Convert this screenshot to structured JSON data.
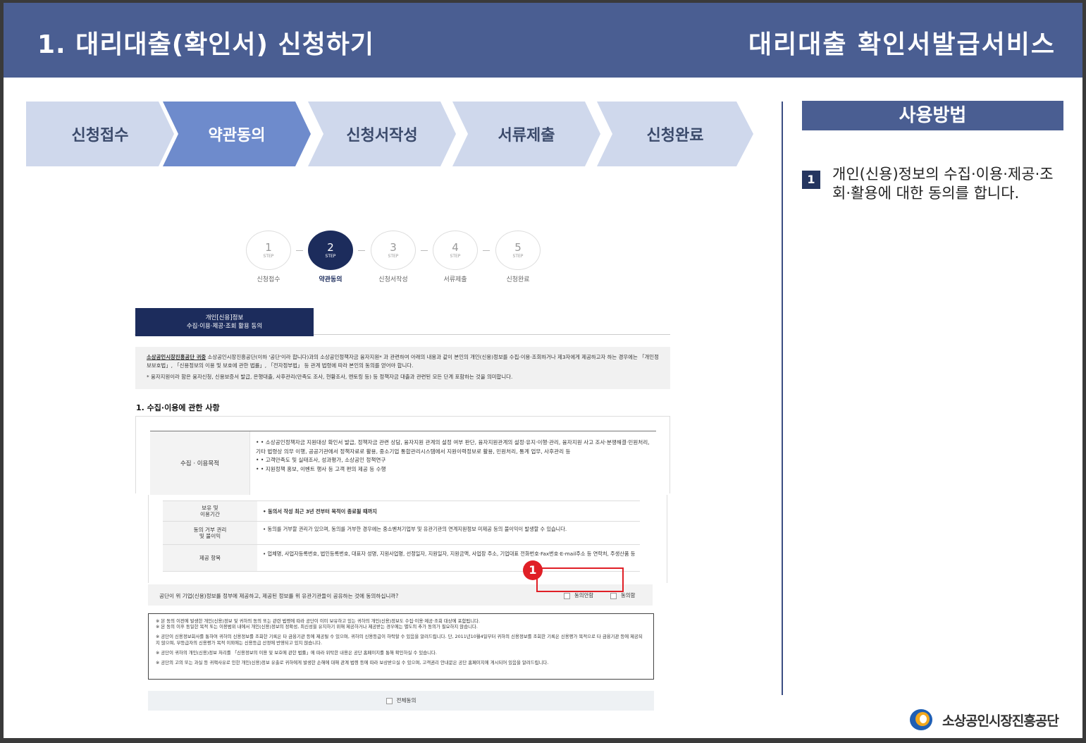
{
  "header": {
    "title": "1. 대리대출(확인서) 신청하기",
    "service": "대리대출 확인서발급서비스"
  },
  "flow": {
    "steps": [
      {
        "label": "신청접수",
        "color": "#cfd8ec"
      },
      {
        "label": "약관동의",
        "color": "#6e8bcc"
      },
      {
        "label": "신청서작성",
        "color": "#cfd8ec"
      },
      {
        "label": "서류제출",
        "color": "#cfd8ec"
      },
      {
        "label": "신청완료",
        "color": "#cfd8ec"
      }
    ],
    "active_index": 1
  },
  "guide": {
    "title": "사용방법",
    "items": [
      {
        "num": "1",
        "text": "개인(신용)정보의 수집·이용·제공·조회·활용에 대한 동의를 합니다."
      }
    ]
  },
  "logo": {
    "name": "소상공인시장진흥공단"
  },
  "screenshot": {
    "steps": [
      {
        "num": "1",
        "sub": "STEP",
        "label": "신청접수"
      },
      {
        "num": "2",
        "sub": "STEP",
        "label": "약관동의"
      },
      {
        "num": "3",
        "sub": "STEP",
        "label": "신청서작성"
      },
      {
        "num": "4",
        "sub": "STEP",
        "label": "서류제출"
      },
      {
        "num": "5",
        "sub": "STEP",
        "label": "신청완료"
      }
    ],
    "tab": {
      "line1": "개인[신용]정보",
      "line2": "수집·이용·제공·조회 활용 동의"
    },
    "notice": {
      "p1_org": "소상공인시장진흥공단 귀중",
      "p1": " 소상공인시장진흥공단(이하 '공단'이라 합니다)과의 소상공인정책자금 융자지원* 과 관련하여 아래의 내용과 같이 본인의 개인(신용)정보를 수집·이용·조회하거나 제3자에게 제공하고자 하는 경우에는 「개인정보보호법」, 「신용정보의 이용 및 보호에 관한 법률」, 「전자정부법」 등 관계 법령에 따라 본인의 동의를 얻어야 합니다.",
      "p2": "* 융자지원이라 함은 융자신청, 신용보증서 발급, 은행대출, 사후관리(만족도 조사, 현황조사, 멘토링 등) 등 정책자금 대출과 관련된 모든 단계 포함하는 것을 의미합니다."
    },
    "section_title": "1. 수집·이용에 관한 사항",
    "purpose": {
      "label": "수집 · 이용목적",
      "lines": [
        "• • 소상공인정책자금 지원대상 확인서 발급, 정책자금 관련 상담, 융자지원 관계의 설정 여부 판단, 융자지원관계의 설정·유지·이행·관리, 융자지원 사고 조사·분쟁해결·민원처리, 기타 법령상 의무 이행, 공공기관에서 정책자료로 활용, 중소기업 통합관리시스템에서 지원이력정보로 활용, 민원처리, 통계 업무, 사후관리 등",
        "• • 고객만족도 및 실태조사, 성과평가, 소상공인 정책연구",
        "• • 지원정책 홍보, 이벤트 행사 등 고객 편의 제공 등 수행"
      ]
    },
    "rows": [
      {
        "label": "보유 및\n이용기간",
        "value": "• 동의서 작성 최근 3년 전부터 목적이 종료될 때까지"
      },
      {
        "label": "동의 거부 권리\n및 불이익",
        "value": "• 동의를 거부할 권리가 있으며, 동의를 거부한 경우에는 중소벤처기업부 및 유관기관의 연계지원정보 미제공 등의 불이익이 발생할 수 있습니다."
      },
      {
        "label": "제공 항목",
        "value": "• 업체명, 사업자등록번호, 법인등록번호, 대표자 성명, 지원사업명, 선정일자, 지원일자, 지원금액, 사업장 주소, 기업대표 전화번호·Fax번호·E-mail주소 등 연락처, 주생산품 등"
      }
    ],
    "consent": {
      "question": "공단이 위 기업(신용)정보를 정부에 제공하고, 제공된 정보를 위 유관기관들이 공유하는 것에 동의하십니까?",
      "disagree": "동의안함",
      "agree": "동의함"
    },
    "marker": "1",
    "notes": [
      "※ 본 동의 이전에 발생한 개인(신용)정보 및 귀하의 동의 또는 관련 법령에 따라 공단이 이미 보유하고 있는 귀하의 개인(신용)정보도 수집·이용·제공·조회 대상에 포함됩니다.\n※ 본 동의 이후 동일한 목적 또는 이용범위 내에서 개인(신용)정보의 정확성, 최신성을 유지하기 위해 제공하거나 제공받는 경우에는 별도의 추가 동의가 필요하지 않습니다.",
      "※ 공단이 신용정보회사를 통하여 귀하의 신용정보를 조회한 기록은 타 금융기관 등에 제공될 수 있으며, 귀하의 신용등급이 하락할 수 있음을 알려드립니다. 단, 2011년10월4일부터 귀하의 신용정보를 조회한 기록은 신용평가 목적으로 타 금융기관 등에 제공되지 않으며, 무등급자의 신용평가 목적 이외에는 신용등급 산정에 반영되고 있지 않습니다.",
      "※ 공단이 귀하의 개인(신용)정보 처리를 「신용정보의 이용 및 보호에 관한 법률」에 따라 위탁한 내용은 공단 홈페이지를 통해 확인하실 수 있습니다.",
      "※ 공단의 고의 또는 과실 등 귀책사유로 인한 개인(신용)정보 유출로 귀하에게 발생한 손해에 대해 관계 법령 등에 따라 보상받으실 수 있으며, 고객권리 안내문은 공단 홈페이지에 게시되어 있음을 알려드립니다."
    ],
    "all_agree": "전체동의"
  }
}
